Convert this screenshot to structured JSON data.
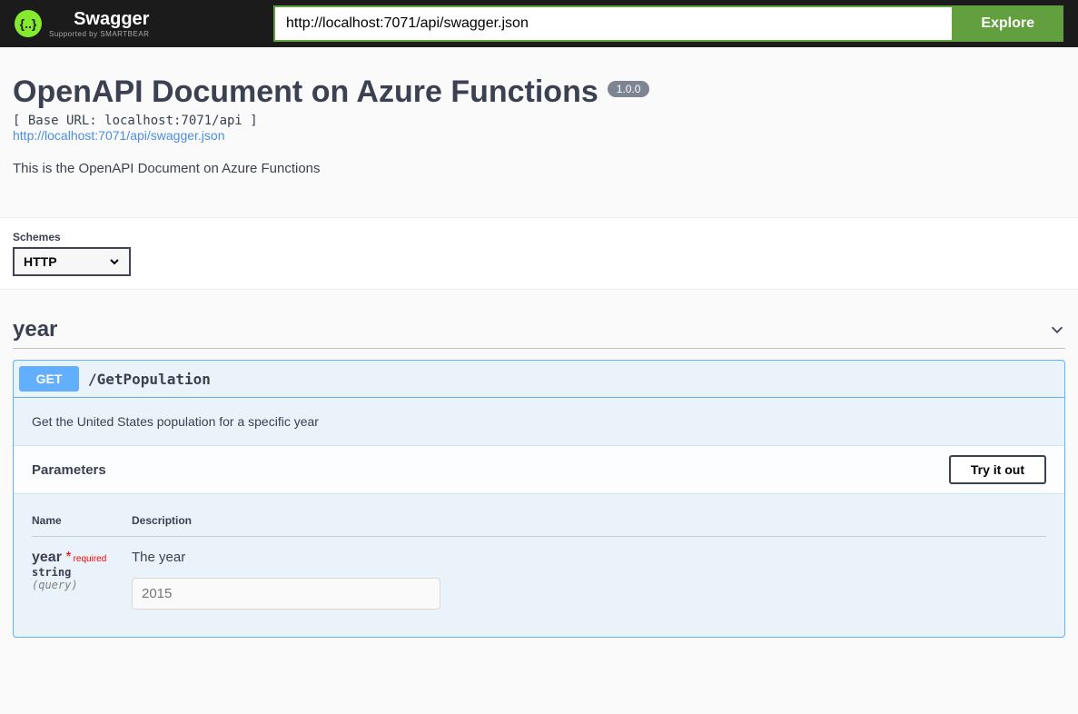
{
  "topbar": {
    "logo_text": "Swagger",
    "logo_sub": "Supported by SMARTBEAR",
    "url_value": "http://localhost:7071/api/swagger.json",
    "explore_label": "Explore"
  },
  "info": {
    "title": "OpenAPI Document on Azure Functions",
    "version": "1.0.0",
    "base_url": "[ Base URL: localhost:7071/api ]",
    "swagger_link": "http://localhost:7071/api/swagger.json",
    "description": "This is the OpenAPI Document on Azure Functions"
  },
  "schemes": {
    "label": "Schemes",
    "selected": "HTTP"
  },
  "tag": {
    "name": "year"
  },
  "operation": {
    "method": "GET",
    "path": "/GetPopulation",
    "summary": "Get the United States population for a specific year",
    "parameters_label": "Parameters",
    "try_it_label": "Try it out",
    "columns": {
      "name": "Name",
      "description": "Description"
    },
    "param": {
      "name": "year",
      "required_text": "required",
      "type": "string",
      "in": "(query)",
      "description": "The year",
      "placeholder": "2015"
    }
  }
}
